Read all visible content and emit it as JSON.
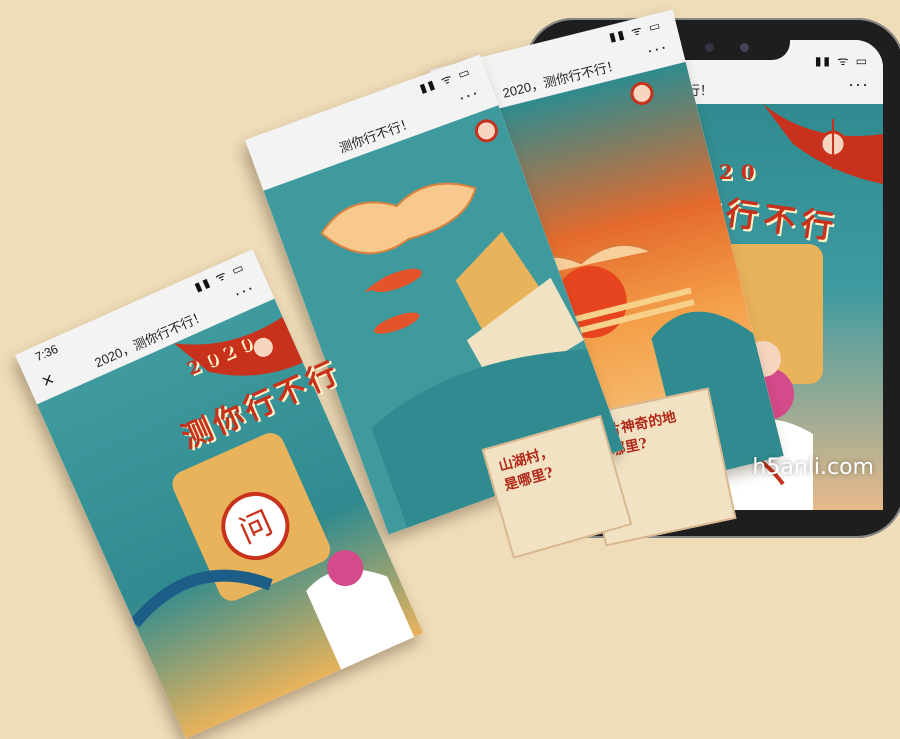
{
  "statusbar": {
    "time": "7:36",
    "icons": "▮▮ ᯤ ▭"
  },
  "titlebar": {
    "title_short": "2020，测你行不行！",
    "title": "测你行不行！",
    "close": "×",
    "more": "···"
  },
  "poster": {
    "year": "2020",
    "heading": "测你行不行",
    "badge": "问",
    "paper_text_1": "山湖村，",
    "paper_text_2": "是哪里?",
    "paper_text_3": "一片神奇的地",
    "paper_text_4": "是哪里?"
  },
  "watermark": "h5anli.com",
  "colors": {
    "background": "#efdcb8",
    "accent": "#c8321c",
    "teal": "#3f9a9e"
  }
}
